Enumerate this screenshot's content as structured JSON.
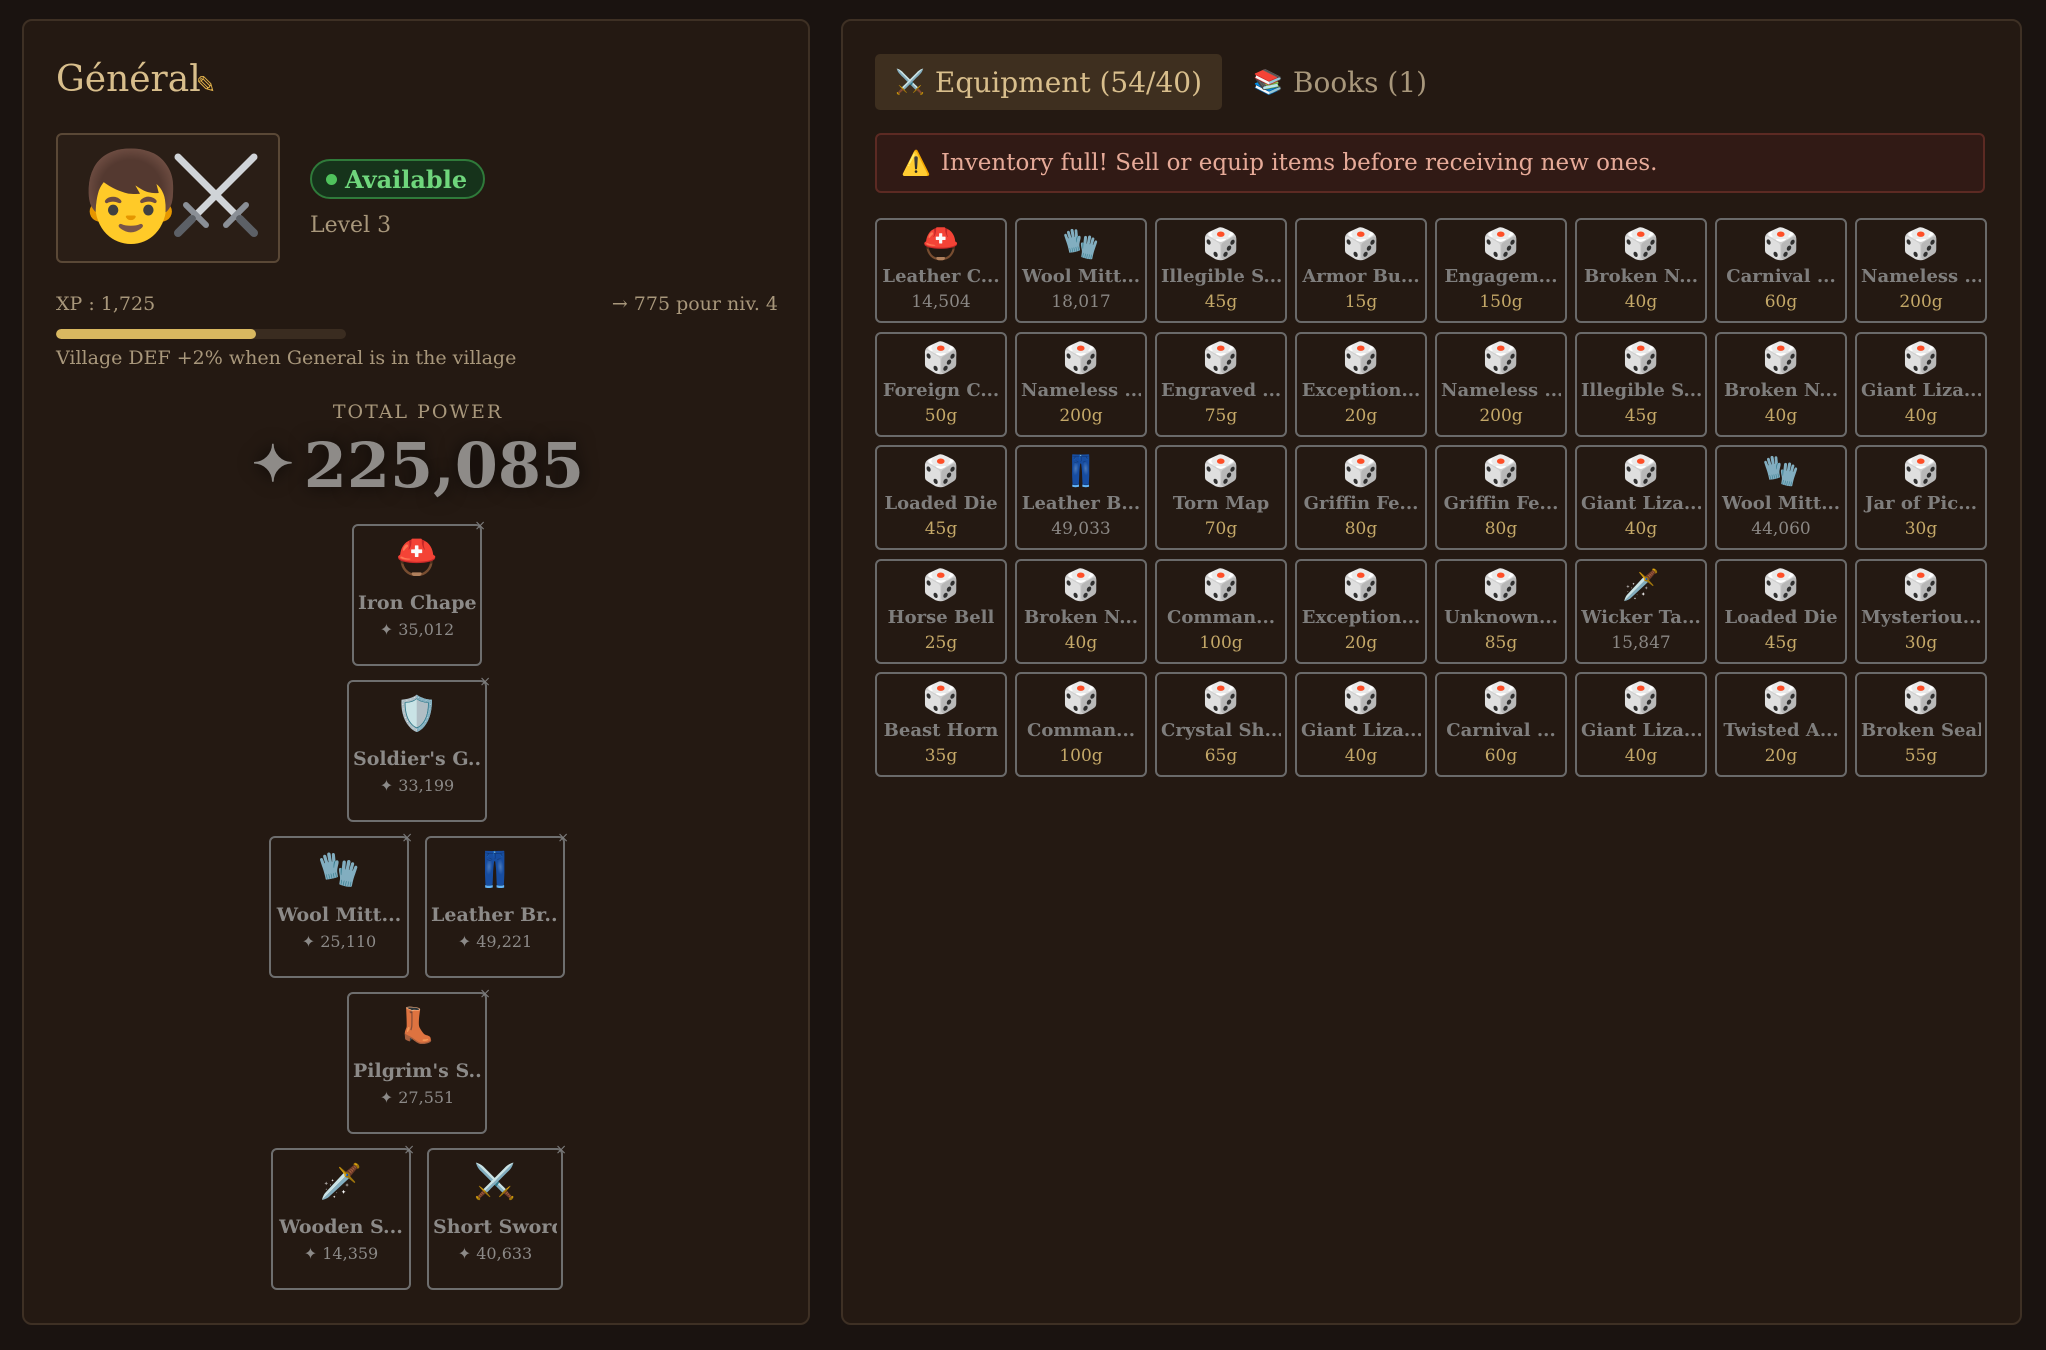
{
  "hero": {
    "name": "Général",
    "status": "Available",
    "level": "Level 3",
    "xp_text": "XP : 1,725",
    "xp_next_text": "→ 775 pour niv. 4",
    "xp_progress": 0.69,
    "bonus_text": "Village DEF +2% when General is in the village",
    "total_power_label": "TOTAL POWER",
    "total_power_value": "225,085"
  },
  "equipped": {
    "head": {
      "name": "Iron Chapel",
      "power": "35,012",
      "icon": "helmet-icon"
    },
    "body": {
      "name": "Soldier's G...",
      "power": "33,199",
      "icon": "shield-icon"
    },
    "hands": {
      "name": "Wool Mitt...",
      "power": "25,110",
      "icon": "gloves-icon"
    },
    "legs": {
      "name": "Leather Br...",
      "power": "49,221",
      "icon": "jeans-icon"
    },
    "feet": {
      "name": "Pilgrim's S...",
      "power": "27,551",
      "icon": "boot-icon"
    },
    "weapon1": {
      "name": "Wooden S...",
      "power": "14,359",
      "icon": "dagger-icon"
    },
    "weapon2": {
      "name": "Short Sword",
      "power": "40,633",
      "icon": "crossed-swords-icon"
    }
  },
  "tabs": {
    "equipment": "Equipment (54/40)",
    "books": "Books (1)"
  },
  "warning": "Inventory full! Sell or equip items before receiving new ones.",
  "inventory": [
    {
      "name": "Leather C...",
      "value": "14,504",
      "icon": "helmet"
    },
    {
      "name": "Wool Mitt...",
      "value": "18,017",
      "icon": "gloves"
    },
    {
      "name": "Illegible S...",
      "value": "45g",
      "icon": "die"
    },
    {
      "name": "Armor Bu...",
      "value": "15g",
      "icon": "die"
    },
    {
      "name": "Engagem...",
      "value": "150g",
      "icon": "die"
    },
    {
      "name": "Broken N...",
      "value": "40g",
      "icon": "die"
    },
    {
      "name": "Carnival ...",
      "value": "60g",
      "icon": "die"
    },
    {
      "name": "Nameless ...",
      "value": "200g",
      "icon": "die"
    },
    {
      "name": "Foreign C...",
      "value": "50g",
      "icon": "die"
    },
    {
      "name": "Nameless ...",
      "value": "200g",
      "icon": "die"
    },
    {
      "name": "Engraved ...",
      "value": "75g",
      "icon": "die"
    },
    {
      "name": "Exception...",
      "value": "20g",
      "icon": "die"
    },
    {
      "name": "Nameless ...",
      "value": "200g",
      "icon": "die"
    },
    {
      "name": "Illegible S...",
      "value": "45g",
      "icon": "die"
    },
    {
      "name": "Broken N...",
      "value": "40g",
      "icon": "die"
    },
    {
      "name": "Giant Liza...",
      "value": "40g",
      "icon": "die"
    },
    {
      "name": "Loaded Die",
      "value": "45g",
      "icon": "die"
    },
    {
      "name": "Leather B...",
      "value": "49,033",
      "icon": "jeans"
    },
    {
      "name": "Torn Map",
      "value": "70g",
      "icon": "die"
    },
    {
      "name": "Griffin Fe...",
      "value": "80g",
      "icon": "die"
    },
    {
      "name": "Griffin Fe...",
      "value": "80g",
      "icon": "die"
    },
    {
      "name": "Giant Liza...",
      "value": "40g",
      "icon": "die"
    },
    {
      "name": "Wool Mitt...",
      "value": "44,060",
      "icon": "gloves"
    },
    {
      "name": "Jar of Pic...",
      "value": "30g",
      "icon": "die"
    },
    {
      "name": "Horse Bell",
      "value": "25g",
      "icon": "die"
    },
    {
      "name": "Broken N...",
      "value": "40g",
      "icon": "die"
    },
    {
      "name": "Comman...",
      "value": "100g",
      "icon": "die"
    },
    {
      "name": "Exception...",
      "value": "20g",
      "icon": "die"
    },
    {
      "name": "Unknown...",
      "value": "85g",
      "icon": "die"
    },
    {
      "name": "Wicker Ta...",
      "value": "15,847",
      "icon": "dagger"
    },
    {
      "name": "Loaded Die",
      "value": "45g",
      "icon": "die"
    },
    {
      "name": "Mysteriou...",
      "value": "30g",
      "icon": "die"
    },
    {
      "name": "Beast Horn",
      "value": "35g",
      "icon": "die"
    },
    {
      "name": "Comman...",
      "value": "100g",
      "icon": "die"
    },
    {
      "name": "Crystal Sh...",
      "value": "65g",
      "icon": "die"
    },
    {
      "name": "Giant Liza...",
      "value": "40g",
      "icon": "die"
    },
    {
      "name": "Carnival ...",
      "value": "60g",
      "icon": "die"
    },
    {
      "name": "Giant Liza...",
      "value": "40g",
      "icon": "die"
    },
    {
      "name": "Twisted A...",
      "value": "20g",
      "icon": "die"
    },
    {
      "name": "Broken Seal",
      "value": "55g",
      "icon": "die"
    }
  ],
  "colors": {
    "accent_gold": "#d9b860",
    "available_green": "#6fd67c",
    "warning_red": "#e6aa98"
  }
}
